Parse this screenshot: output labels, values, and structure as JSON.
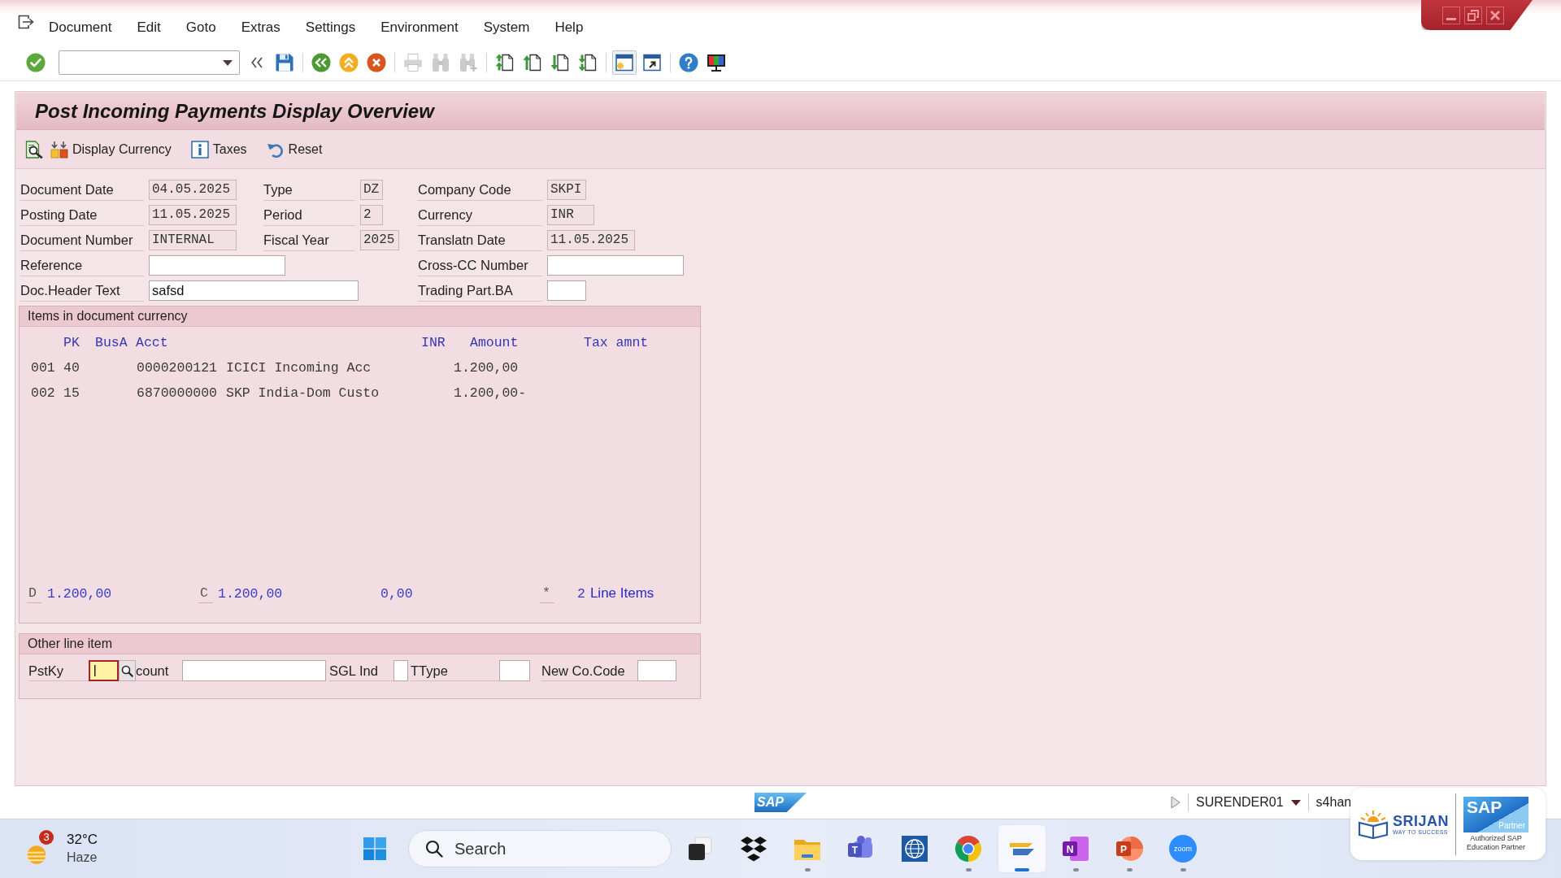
{
  "menu_bar": {
    "items": [
      "Document",
      "Edit",
      "Goto",
      "Extras",
      "Settings",
      "Environment",
      "System",
      "Help"
    ]
  },
  "toolbar": {
    "groups": [
      [
        {
          "kind": "enter",
          "disabled": false,
          "highlighted": false
        },
        {
          "kind": "command_field",
          "disabled": false,
          "highlighted": false
        },
        {
          "kind": "collapse",
          "disabled": false,
          "highlighted": false
        },
        {
          "kind": "save",
          "disabled": false,
          "highlighted": false
        }
      ],
      [
        {
          "kind": "back",
          "disabled": false,
          "highlighted": false
        },
        {
          "kind": "exit",
          "disabled": false,
          "highlighted": false
        },
        {
          "kind": "cancel",
          "disabled": false,
          "highlighted": false
        }
      ],
      [
        {
          "kind": "print",
          "disabled": true,
          "highlighted": false
        },
        {
          "kind": "find",
          "disabled": true,
          "highlighted": false
        },
        {
          "kind": "find_next",
          "disabled": true,
          "highlighted": false
        }
      ],
      [
        {
          "kind": "first_page",
          "disabled": false,
          "highlighted": false
        },
        {
          "kind": "previous_page",
          "disabled": false,
          "highlighted": false
        },
        {
          "kind": "next_page",
          "disabled": false,
          "highlighted": false
        },
        {
          "kind": "last_page",
          "disabled": false,
          "highlighted": false
        }
      ],
      [
        {
          "kind": "new_session",
          "disabled": false,
          "highlighted": true
        },
        {
          "kind": "shortcut",
          "disabled": false,
          "highlighted": false
        }
      ],
      [
        {
          "kind": "help",
          "disabled": false,
          "highlighted": false
        },
        {
          "kind": "layout",
          "disabled": false,
          "highlighted": false
        }
      ]
    ]
  },
  "screen": {
    "title": "Post Incoming Payments Display Overview",
    "toolbar": [
      {
        "kind": "overview"
      },
      {
        "kind": "display_currency",
        "label": "Display Currency"
      },
      {
        "kind": "taxes",
        "label": "Taxes"
      },
      {
        "kind": "reset",
        "label": "Reset"
      }
    ]
  },
  "header": {
    "columns": [
      [
        {
          "label": "Document Date",
          "value": "04.05.2025",
          "editable": false
        },
        {
          "label": "Posting Date",
          "value": "11.05.2025",
          "editable": false
        },
        {
          "label": "Document Number",
          "value": "INTERNAL",
          "editable": false
        },
        {
          "label": "Reference",
          "editable": true
        },
        {
          "label": "Doc.Header Text",
          "value": "safsd",
          "editable": true
        }
      ],
      [
        {
          "label": "Type",
          "value": "DZ",
          "editable": false
        },
        {
          "label": "Period",
          "value": "2",
          "editable": false
        },
        {
          "label": "Fiscal Year",
          "value": "2025",
          "editable": false
        }
      ],
      [
        {
          "label": "Company Code",
          "value": "SKPI",
          "editable": false
        },
        {
          "label": "Currency",
          "value": "INR",
          "editable": false
        },
        {
          "label": "Translatn Date",
          "value": "11.05.2025",
          "editable": false
        },
        {
          "label": "Cross-CC Number",
          "editable": true
        },
        {
          "label": "Trading Part.BA",
          "editable": true
        }
      ]
    ]
  },
  "items": {
    "title": "Items in document currency",
    "columns": [
      "PK",
      "BusA",
      "Acct",
      "INR",
      "Amount",
      "Tax amnt"
    ],
    "rows": [
      {
        "line": "001",
        "pk": "40",
        "acct": "0000200121",
        "short_text": "ICICI Incoming Acc",
        "amount": "1.200,00"
      },
      {
        "line": "002",
        "pk": "15",
        "acct": "6870000000",
        "short_text": "SKP India-Dom Custo",
        "amount": "1.200,00-"
      }
    ],
    "totals": {
      "debit_marker": "D",
      "debit": "1.200,00",
      "credit_marker": "C",
      "credit": "1.200,00",
      "balance": "0,00",
      "status_marker": "*",
      "count": "2",
      "count_label": "Line Items"
    }
  },
  "other_line_item": {
    "title": "Other line item",
    "fields": [
      {
        "label": "PstKy",
        "focused": true,
        "search_help": true
      },
      {
        "label": "count",
        "focused": false,
        "search_help": false
      },
      {
        "label": "SGL Ind",
        "focused": false,
        "search_help": false
      },
      {
        "label": "TType",
        "focused": false,
        "search_help": false
      },
      {
        "label": "New Co.Code",
        "focused": false,
        "search_help": false
      }
    ]
  },
  "status_bar": {
    "logo": "SAP",
    "user": "SURENDER01",
    "system": "s4han"
  },
  "taskbar": {
    "weather": {
      "badge": "3",
      "temperature": "32°C",
      "condition": "Haze"
    },
    "search": {
      "placeholder": "Search"
    },
    "apps": [
      {
        "kind": "task_view",
        "running": false,
        "selected": false
      },
      {
        "kind": "dropbox",
        "running": false,
        "selected": false
      },
      {
        "kind": "explorer",
        "running": true,
        "selected": false
      },
      {
        "kind": "teams",
        "glyph": "T",
        "running": false,
        "selected": false
      },
      {
        "kind": "globe",
        "running": false,
        "selected": false
      },
      {
        "kind": "chrome",
        "running": true,
        "selected": false
      },
      {
        "kind": "sap_logon",
        "running": true,
        "selected": true
      },
      {
        "kind": "onenote",
        "glyph": "N",
        "running": true,
        "selected": false
      },
      {
        "kind": "powerpoint",
        "glyph": "P",
        "running": true,
        "selected": false
      },
      {
        "kind": "zoom",
        "glyph": "zoom",
        "running": true,
        "selected": false
      }
    ]
  },
  "branding": {
    "name": "SRIJAN",
    "tagline": "WAY TO SUCCESS",
    "partner_logo": "SAP",
    "partner_tag": "Partner",
    "partner_caption": "Authorized SAP Education Partner"
  }
}
